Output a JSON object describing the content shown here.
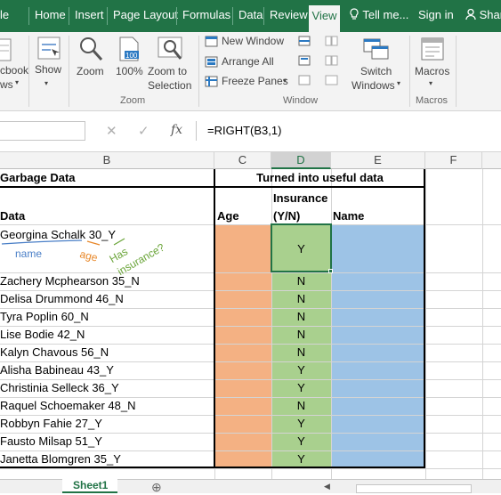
{
  "tabs": [
    "le",
    "Home",
    "Insert",
    "Page Layout",
    "Formulas",
    "Data",
    "Review",
    "View"
  ],
  "tellme": "Tell me...",
  "signin": "Sign in",
  "share": "Shar",
  "ribbon": {
    "wb_views_1": "cbook",
    "wb_views_2": "ws",
    "show": "Show",
    "zoom": "Zoom",
    "zoom100": "100%",
    "zoom_sel_1": "Zoom to",
    "zoom_sel_2": "Selection",
    "new_window": "New Window",
    "arrange_all": "Arrange All",
    "freeze": "Freeze Panes",
    "switch_1": "Switch",
    "switch_2": "Windows",
    "macros": "Macros",
    "grp_zoom": "Zoom",
    "grp_window": "Window",
    "grp_macros": "Macros"
  },
  "formula": {
    "fx": "fx",
    "text": "=RIGHT(B3,1)"
  },
  "columns": [
    "B",
    "C",
    "D",
    "E",
    "F"
  ],
  "sheet": {
    "garbage_header": "Garbage Data",
    "useful_header": "Turned into useful data",
    "col_data": "Data",
    "col_age": "Age",
    "col_ins_1": "Insurance",
    "col_ins_2": "(Y/N)",
    "col_name": "Name",
    "first": {
      "data": "Georgina Schalk 30_Y",
      "ins": "Y"
    },
    "notes": {
      "name": "name",
      "age": "age",
      "has": "Has",
      "insurance": "insurance?"
    },
    "rows": [
      {
        "data": "Zachery Mcphearson 35_N",
        "ins": "N"
      },
      {
        "data": "Delisa Drummond 46_N",
        "ins": "N"
      },
      {
        "data": "Tyra Poplin 60_N",
        "ins": "N"
      },
      {
        "data": "Lise Bodie 42_N",
        "ins": "N"
      },
      {
        "data": "Kalyn Chavous 56_N",
        "ins": "N"
      },
      {
        "data": "Alisha Babineau 43_Y",
        "ins": "Y"
      },
      {
        "data": "Christinia Selleck 36_Y",
        "ins": "Y"
      },
      {
        "data": "Raquel Schoemaker 48_N",
        "ins": "N"
      },
      {
        "data": "Robbyn Fahie 27_Y",
        "ins": "Y"
      },
      {
        "data": "Fausto Milsap 51_Y",
        "ins": "Y"
      },
      {
        "data": "Janetta Blomgren 35_Y",
        "ins": "Y"
      }
    ]
  },
  "sheet_tab": "Sheet1",
  "colors": {
    "excel_green": "#217346",
    "age_fill": "#f4b183",
    "ins_fill": "#a9d08e",
    "name_fill": "#9dc3e6"
  }
}
